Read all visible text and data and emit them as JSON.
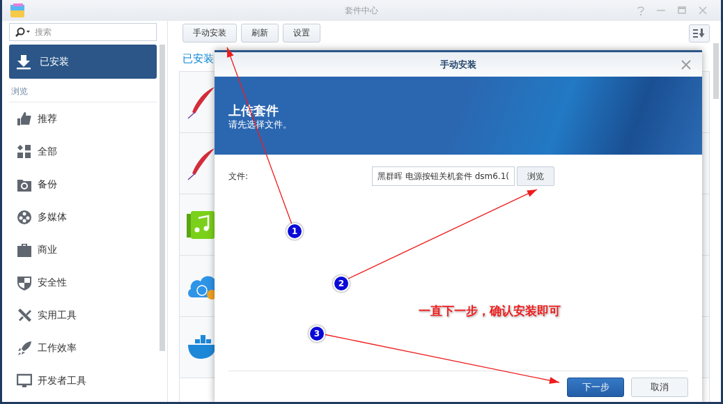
{
  "window": {
    "title": "套件中心"
  },
  "sidebar": {
    "search": {
      "placeholder": "搜索"
    },
    "main_items": [
      {
        "label": "已安装",
        "kind": "download",
        "selected": true
      }
    ],
    "section": "浏览",
    "categories": [
      {
        "label": "推荐",
        "kind": "thumb",
        "selected": false
      },
      {
        "label": "全部",
        "kind": "grid",
        "selected": false
      },
      {
        "label": "备份",
        "kind": "backup",
        "selected": false
      },
      {
        "label": "多媒体",
        "kind": "film",
        "selected": false
      },
      {
        "label": "商业",
        "kind": "briefcase",
        "selected": false
      },
      {
        "label": "安全性",
        "kind": "shield",
        "selected": false
      },
      {
        "label": "实用工具",
        "kind": "tools",
        "selected": false
      },
      {
        "label": "工作效率",
        "kind": "rocket",
        "selected": false
      },
      {
        "label": "开发者工具",
        "kind": "monitor",
        "selected": false
      }
    ]
  },
  "toolbar": {
    "buttons": [
      "手动安装",
      "刷新",
      "设置"
    ]
  },
  "content": {
    "heading": "已安装",
    "packages": [
      {
        "kind": "feather"
      },
      {
        "kind": "feather"
      },
      {
        "kind": "music"
      },
      {
        "kind": "cloud"
      },
      {
        "kind": "whale"
      }
    ]
  },
  "dialog": {
    "title": "手动安装",
    "banner_title": "上传套件",
    "banner_subtitle": "请先选择文件。",
    "file_label": "文件:",
    "file_value": "黑群晖 电源按钮关机套件 dsm6.1(",
    "browse": "浏览",
    "buttons": [
      {
        "label": "下一步",
        "primary": true
      },
      {
        "label": "取消",
        "primary": false
      }
    ]
  },
  "annotations": {
    "markers": [
      "1",
      "2",
      "3"
    ],
    "note": "一直下一步，确认安装即可"
  }
}
